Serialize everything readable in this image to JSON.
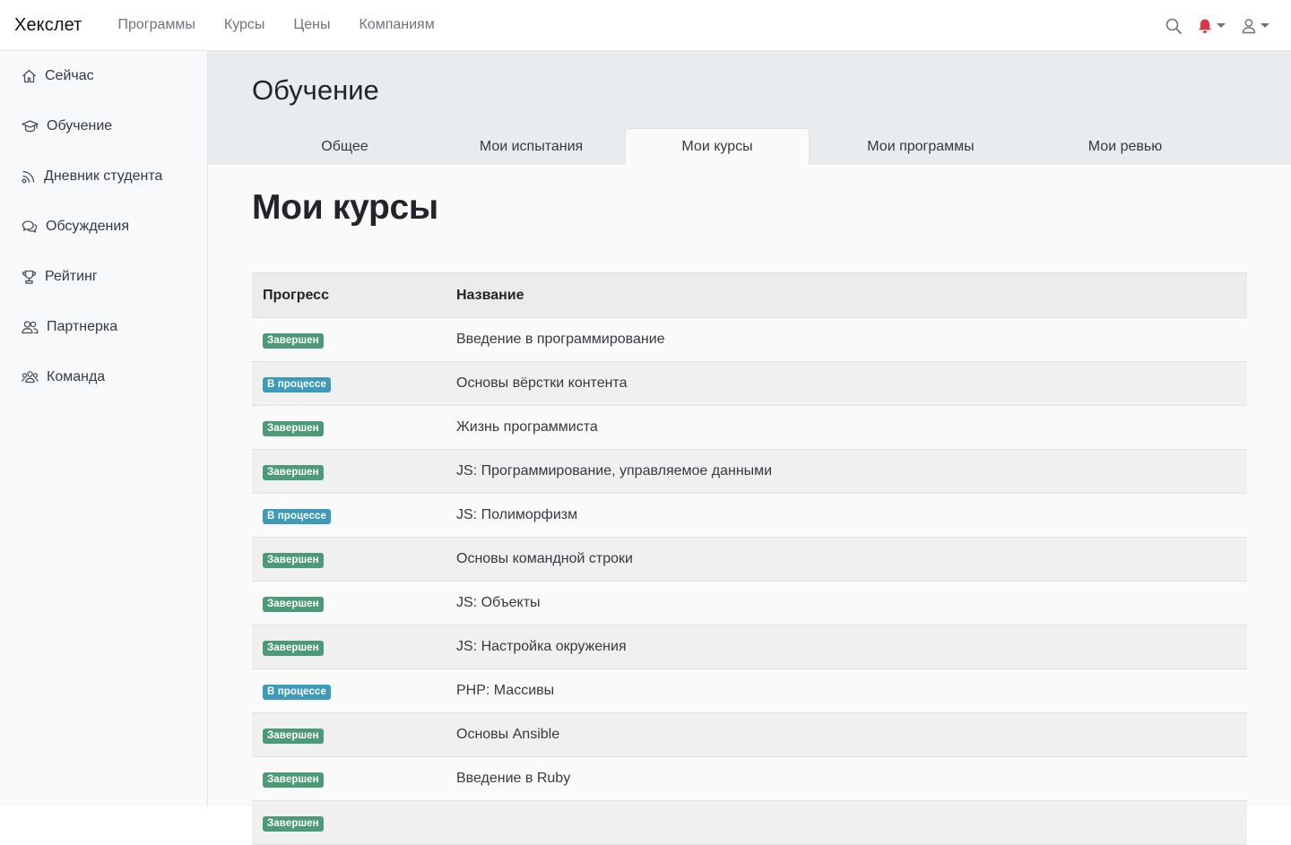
{
  "header": {
    "brand": "Хекслет",
    "nav": [
      {
        "label": "Программы"
      },
      {
        "label": "Курсы"
      },
      {
        "label": "Цены"
      },
      {
        "label": "Компаниям"
      }
    ],
    "icons": {
      "search": "search-icon",
      "bell": "bell-icon",
      "user": "user-icon"
    },
    "bell_color": "#dc3545"
  },
  "sidebar": {
    "items": [
      {
        "label": "Сейчас",
        "icon": "home-icon"
      },
      {
        "label": "Обучение",
        "icon": "graduation-cap-icon"
      },
      {
        "label": "Дневник студента",
        "icon": "rss-icon"
      },
      {
        "label": "Обсуждения",
        "icon": "comments-icon"
      },
      {
        "label": "Рейтинг",
        "icon": "trophy-icon"
      },
      {
        "label": "Партнерка",
        "icon": "users-icon"
      },
      {
        "label": "Команда",
        "icon": "team-icon"
      }
    ]
  },
  "page": {
    "title": "Обучение",
    "tabs": [
      {
        "label": "Общее"
      },
      {
        "label": "Мои испытания"
      },
      {
        "label": "Мои курсы",
        "active": true
      },
      {
        "label": "Мои программы"
      },
      {
        "label": "Мои ревью"
      }
    ],
    "section_title": "Мои курсы"
  },
  "table": {
    "headers": {
      "progress": "Прогресс",
      "name": "Название"
    },
    "rows": [
      {
        "status": "Завершен",
        "state": "done",
        "name": "Введение в программирование"
      },
      {
        "status": "В процессе",
        "state": "progress",
        "name": "Основы вёрстки контента"
      },
      {
        "status": "Завершен",
        "state": "done",
        "name": "Жизнь программиста"
      },
      {
        "status": "Завершен",
        "state": "done",
        "name": "JS: Программирование, управляемое данными"
      },
      {
        "status": "В процессе",
        "state": "progress",
        "name": "JS: Полиморфизм"
      },
      {
        "status": "Завершен",
        "state": "done",
        "name": "Основы командной строки"
      },
      {
        "status": "Завершен",
        "state": "done",
        "name": "JS: Объекты"
      },
      {
        "status": "Завершен",
        "state": "done",
        "name": "JS: Настройка окружения"
      },
      {
        "status": "В процессе",
        "state": "progress",
        "name": "PHP: Массивы"
      },
      {
        "status": "Завершен",
        "state": "done",
        "name": "Основы Ansible"
      },
      {
        "status": "Завершен",
        "state": "done",
        "name": "Введение в Ruby"
      },
      {
        "status": "Завершен",
        "state": "done",
        "name": ""
      }
    ]
  },
  "colors": {
    "done_badge": "#4c9a77",
    "progress_badge": "#3d9ab8"
  }
}
